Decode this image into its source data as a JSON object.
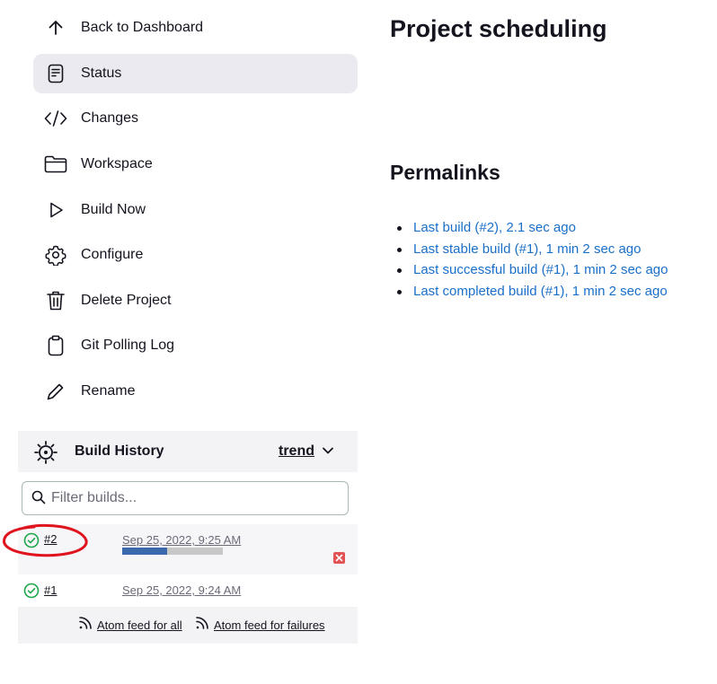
{
  "sidebar": {
    "items": [
      {
        "label": "Back to Dashboard",
        "icon": "arrow-up-icon"
      },
      {
        "label": "Status",
        "icon": "document-icon"
      },
      {
        "label": "Changes",
        "icon": "code-icon"
      },
      {
        "label": "Workspace",
        "icon": "folder-icon"
      },
      {
        "label": "Build Now",
        "icon": "play-icon"
      },
      {
        "label": "Configure",
        "icon": "gear-icon"
      },
      {
        "label": "Delete Project",
        "icon": "trash-icon"
      },
      {
        "label": "Git Polling Log",
        "icon": "clipboard-icon"
      },
      {
        "label": "Rename",
        "icon": "pencil-icon"
      }
    ]
  },
  "build_history": {
    "title": "Build History",
    "trend_label": "trend",
    "filter_placeholder": "Filter builds...",
    "builds": [
      {
        "number": "#2",
        "date": "Sep 25, 2022, 9:25 AM",
        "status": "success",
        "progress": 0.45
      },
      {
        "number": "#1",
        "date": "Sep 25, 2022, 9:24 AM",
        "status": "success"
      }
    ],
    "feed_all": "Atom feed for all",
    "feed_failures": "Atom feed for failures"
  },
  "main": {
    "title": "Project scheduling",
    "permalinks_title": "Permalinks",
    "permalinks": [
      "Last build (#2), 2.1 sec ago",
      "Last stable build (#1), 1 min 2 sec ago",
      "Last successful build (#1), 1 min 2 sec ago",
      "Last completed build (#1), 1 min 2 sec ago"
    ]
  },
  "colors": {
    "accent_link": "#1a6fc9",
    "active_bg": "#eaeaf0",
    "success": "#1ea64b",
    "annotation": "#e0141e",
    "progress": "#3a68ad"
  }
}
